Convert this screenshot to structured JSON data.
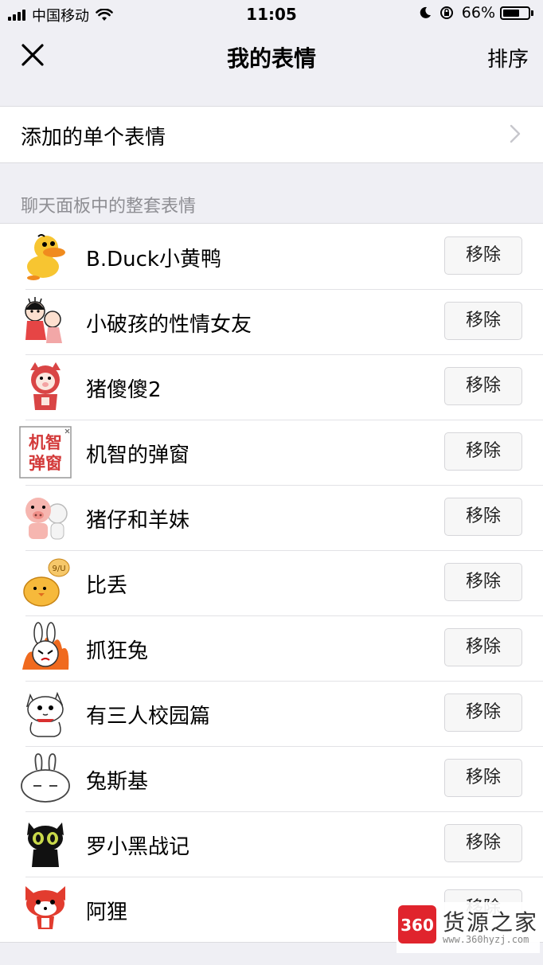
{
  "status_bar": {
    "carrier": "中国移动",
    "time": "11:05",
    "battery": "66%",
    "battery_level": 0.66
  },
  "nav": {
    "title": "我的表情",
    "sort_label": "排序",
    "close_icon": "close-icon"
  },
  "single": {
    "label": "添加的单个表情",
    "chevron_icon": "chevron-right-icon"
  },
  "section_header": "聊天面板中的整套表情",
  "remove_label": "移除",
  "packs": [
    {
      "name": "B.Duck小黄鸭",
      "icon": "yellow-duck-icon"
    },
    {
      "name": "小破孩的性情女友",
      "icon": "kid-couple-icon"
    },
    {
      "name": "猪傻傻2",
      "icon": "red-pig-icon"
    },
    {
      "name": "机智的弹窗",
      "icon": "popup-text-icon",
      "icon_text_top": "机智",
      "icon_text_bottom": "弹窗"
    },
    {
      "name": "猪仔和羊妹",
      "icon": "pig-sheep-icon"
    },
    {
      "name": "比丢",
      "icon": "chick-icon",
      "icon_text": "9/U"
    },
    {
      "name": "抓狂兔",
      "icon": "angry-rabbit-icon"
    },
    {
      "name": "有三人校园篇",
      "icon": "white-cat-icon"
    },
    {
      "name": "兔斯基",
      "icon": "tuzki-icon"
    },
    {
      "name": "罗小黑战记",
      "icon": "black-cat-icon"
    },
    {
      "name": "阿狸",
      "icon": "red-fox-icon"
    }
  ],
  "watermark": {
    "logo_text": "360",
    "title": "货源之家",
    "url": "www.360hyzj.com"
  },
  "colors": {
    "background": "#efeff4",
    "separator": "#e2e2e6",
    "secondary_text": "#8e8e93",
    "watermark_red": "#e0242d"
  }
}
